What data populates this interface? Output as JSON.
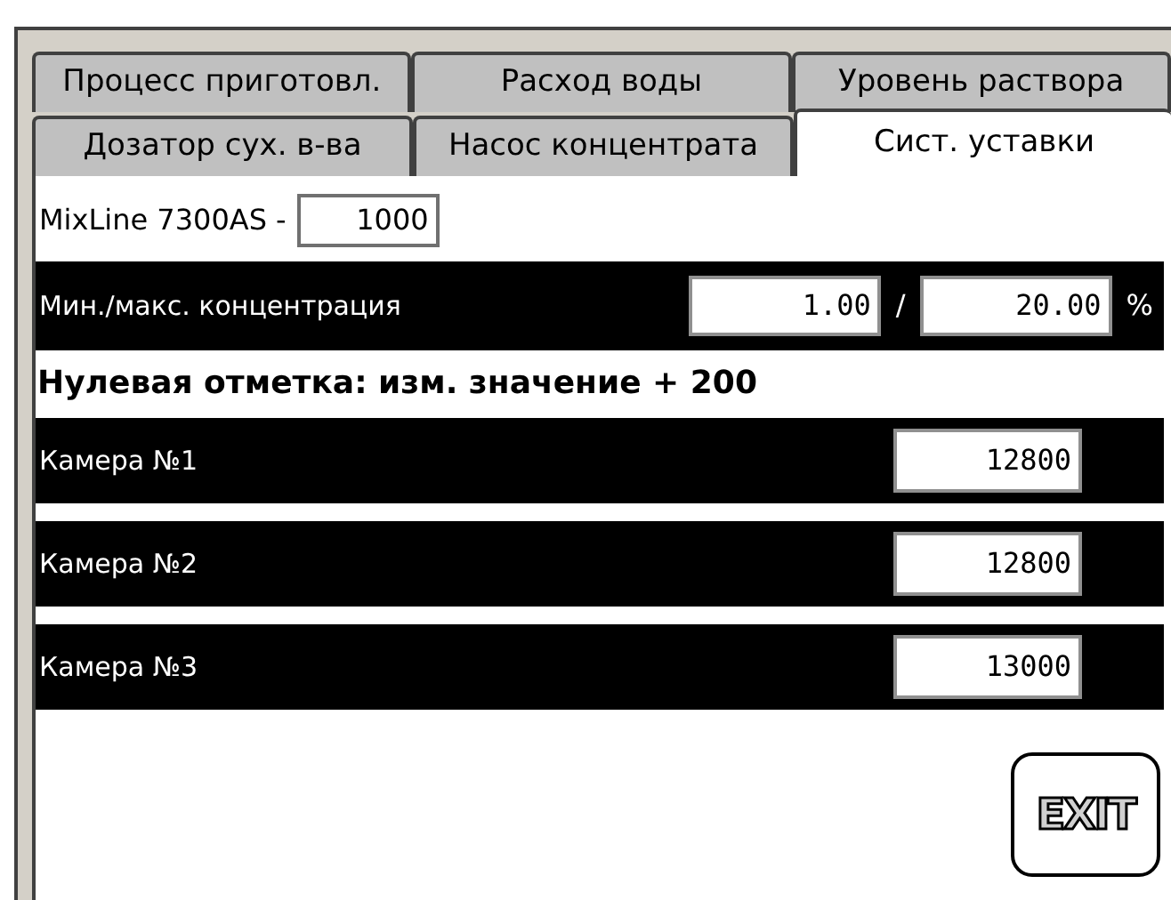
{
  "tab_rows": [
    [
      {
        "label": "Процесс приготовл.",
        "selected": false
      },
      {
        "label": "Расход воды",
        "selected": false
      },
      {
        "label": "Уровень раствора",
        "selected": false
      }
    ],
    [
      {
        "label": "Дозатор сух. в-ва",
        "selected": false
      },
      {
        "label": "Насос концентрата",
        "selected": false
      },
      {
        "label": "Сист. уставки",
        "selected": true
      }
    ]
  ],
  "model": {
    "label": "MixLine 7300AS -",
    "value": "1000"
  },
  "concentration": {
    "label": "Мин./макс. концентрация",
    "min": "1.00",
    "separator": "/",
    "max": "20.00",
    "unit": "%"
  },
  "zero_mark": "Нулевая отметка: изм. значение + 200",
  "chambers": [
    {
      "label": "Камера №1",
      "value": "12800"
    },
    {
      "label": "Камера №2",
      "value": "12800"
    },
    {
      "label": "Камера №3",
      "value": "13000"
    }
  ],
  "exit_button": "EXIT"
}
